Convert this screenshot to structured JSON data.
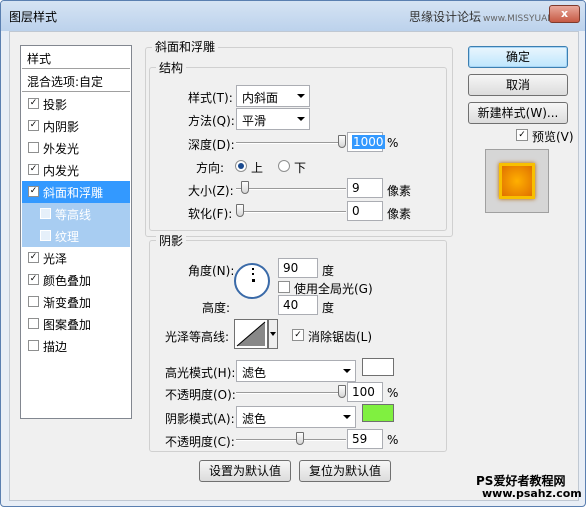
{
  "window": {
    "title": "图层样式",
    "watermark": "思缘设计论坛",
    "watermark_url": "www.MISSYUAN.com",
    "close": "x"
  },
  "sidebar": {
    "header": "样式",
    "blend": "混合选项:自定",
    "items": [
      {
        "label": "投影",
        "checked": true
      },
      {
        "label": "内阴影",
        "checked": true
      },
      {
        "label": "外发光",
        "checked": false
      },
      {
        "label": "内发光",
        "checked": true
      },
      {
        "label": "斜面和浮雕",
        "checked": true
      },
      {
        "label": "等高线",
        "checked": false
      },
      {
        "label": "纹理",
        "checked": false
      },
      {
        "label": "光泽",
        "checked": true
      },
      {
        "label": "颜色叠加",
        "checked": true
      },
      {
        "label": "渐变叠加",
        "checked": false
      },
      {
        "label": "图案叠加",
        "checked": false
      },
      {
        "label": "描边",
        "checked": false
      }
    ]
  },
  "bevel": {
    "group_title": "斜面和浮雕",
    "structure_title": "结构",
    "style_label": "样式(T):",
    "style_value": "内斜面",
    "technique_label": "方法(Q):",
    "technique_value": "平滑",
    "depth_label": "深度(D):",
    "depth_value": "1000",
    "depth_unit": "%",
    "depth_level": 1.0,
    "direction_label": "方向:",
    "dir_up": "上",
    "dir_down": "下",
    "size_label": "大小(Z):",
    "size_value": "9",
    "size_unit": "像素",
    "size_level": 0.05,
    "soften_label": "软化(F):",
    "soften_value": "0",
    "soften_unit": "像素",
    "soften_level": 0.0
  },
  "shading": {
    "title": "阴影",
    "angle_label": "角度(N):",
    "angle_value": "90",
    "angle_unit": "度",
    "global_light": "使用全局光(G)",
    "altitude_label": "高度:",
    "altitude_value": "40",
    "altitude_unit": "度",
    "gloss_label": "光泽等高线:",
    "antialias": "消除锯齿(L)",
    "highlight_label": "高光模式(H):",
    "highlight_mode": "滤色",
    "highlight_color": "#ffffff",
    "hl_opacity_label": "不透明度(O):",
    "hl_opacity": "100",
    "hl_unit": "%",
    "hl_level": 1.0,
    "shadow_label": "阴影模式(A):",
    "shadow_mode": "滤色",
    "shadow_color": "#80f040",
    "sh_opacity_label": "不透明度(C):",
    "sh_opacity": "59",
    "sh_unit": "%",
    "sh_level": 0.59
  },
  "buttons": {
    "make_default": "设置为默认值",
    "reset_default": "复位为默认值",
    "ok": "确定",
    "cancel": "取消",
    "new_style": "新建样式(W)...",
    "preview": "预览(V)"
  },
  "footer": {
    "site_name": "PS爱好者教程网",
    "site_url": "www.psahz.com"
  }
}
